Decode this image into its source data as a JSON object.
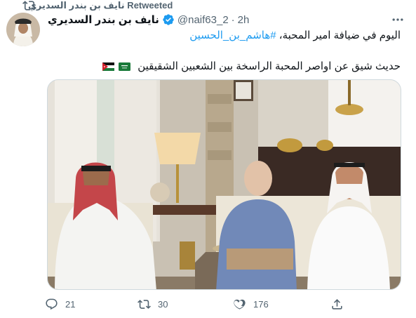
{
  "retweet": {
    "label": "نايف بن بندر السديري Retweeted"
  },
  "tweet": {
    "display_name": "نايف بن بندر السديري",
    "handle": "@naif63_2",
    "separator": "·",
    "time": "2h",
    "line1_text": "اليوم في ضيافة امير المحبة، ",
    "hashtag": "#هاشم_بن_الحسين",
    "line2_text": "حديث شيق عن اواصر المحبة الراسخة بين الشعبين الشقيقين",
    "flags": [
      "saudi-arabia-flag",
      "jordan-flag"
    ]
  },
  "actions": {
    "reply_count": "21",
    "retweet_count": "30",
    "like_count": "176"
  },
  "colors": {
    "accent": "#1d9bf0",
    "muted": "#536471",
    "text": "#0f1419"
  }
}
